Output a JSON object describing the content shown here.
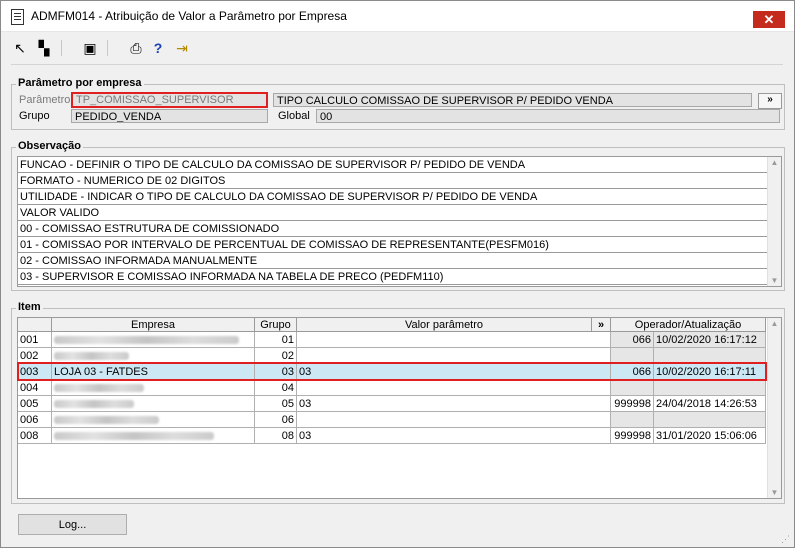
{
  "window": {
    "title": "ADMFM014 - Atribuição de Valor a Parâmetro por Empresa",
    "close_label": "✕"
  },
  "toolbar": {
    "buttons": [
      {
        "name": "first-record-button",
        "icon": "↖"
      },
      {
        "name": "copy-record-button",
        "icon": "▚"
      },
      {
        "name": "save-button",
        "icon": "▣"
      },
      {
        "name": "print-button",
        "icon": "⎙"
      },
      {
        "name": "help-button",
        "icon": "?"
      },
      {
        "name": "exit-button",
        "icon": "⇥"
      }
    ]
  },
  "param_section": {
    "title": "Parâmetro por empresa",
    "parametro_label": "Parâmetro",
    "parametro_value": "TP_COMISSAO_SUPERVISOR",
    "parametro_desc": "TIPO CALCULO COMISSAO DE SUPERVISOR P/ PEDIDO VENDA",
    "more_button": "»",
    "grupo_label": "Grupo",
    "grupo_value": "PEDIDO_VENDA",
    "global_label": "Global",
    "global_value": "00"
  },
  "observacao": {
    "title": "Observação",
    "lines": [
      "FUNCAO - DEFINIR O TIPO DE CALCULO DA COMISSAO DE SUPERVISOR P/ PEDIDO DE VENDA",
      "FORMATO - NUMERICO DE 02 DIGITOS",
      "UTILIDADE - INDICAR O TIPO DE CALCULO DA COMISSAO DE SUPERVISOR P/ PEDIDO DE VENDA",
      "VALOR VALIDO",
      "00 - COMISSAO ESTRUTURA DE COMISSIONADO",
      "01 - COMISSAO POR INTERVALO DE PERCENTUAL DE COMISSAO DE REPRESENTANTE(PESFM016)",
      "02 - COMISSAO INFORMADA MANUALMENTE",
      "03 - SUPERVISOR E COMISSAO INFORMADA NA TABELA DE PRECO (PEDFM110)"
    ]
  },
  "item": {
    "title": "Item",
    "headers": {
      "empresa": "Empresa",
      "grupo": "Grupo",
      "valor": "Valor parâmetro",
      "more": "»",
      "operador": "Operador/Atualização"
    },
    "rows": [
      {
        "code": "001",
        "empresa": "",
        "grupo": "01",
        "valor": "",
        "operador": "066",
        "atualizacao": "10/02/2020 16:17:12"
      },
      {
        "code": "002",
        "empresa": "",
        "grupo": "02",
        "valor": "",
        "operador": "",
        "atualizacao": ""
      },
      {
        "code": "003",
        "empresa": "LOJA 03 - FATDES",
        "grupo": "03",
        "valor": "03",
        "operador": "066",
        "atualizacao": "10/02/2020 16:17:11"
      },
      {
        "code": "004",
        "empresa": "",
        "grupo": "04",
        "valor": "",
        "operador": "",
        "atualizacao": ""
      },
      {
        "code": "005",
        "empresa": "",
        "grupo": "05",
        "valor": "03",
        "operador": "999998",
        "atualizacao": "24/04/2018 14:26:53"
      },
      {
        "code": "006",
        "empresa": "",
        "grupo": "06",
        "valor": "",
        "operador": "",
        "atualizacao": ""
      },
      {
        "code": "008",
        "empresa": "",
        "grupo": "08",
        "valor": "03",
        "operador": "999998",
        "atualizacao": "31/01/2020 15:06:06"
      }
    ]
  },
  "log_button": "Log..."
}
